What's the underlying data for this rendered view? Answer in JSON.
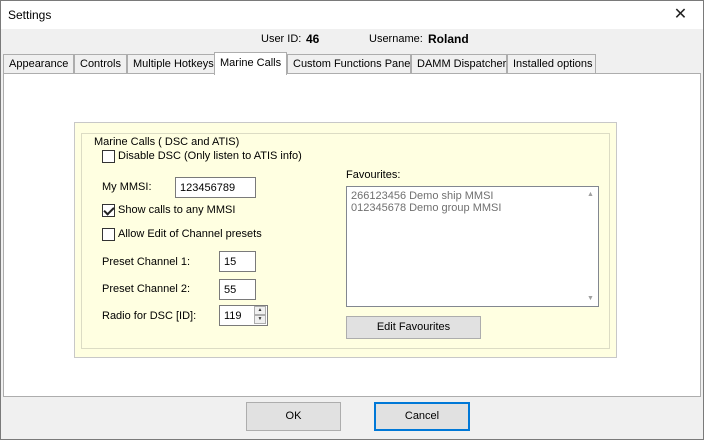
{
  "window": {
    "title": "Settings",
    "close_glyph": "✕"
  },
  "info": {
    "user_id_label": "User ID:",
    "user_id_value": "46",
    "username_label": "Username:",
    "username_value": "Roland"
  },
  "tabs": [
    {
      "label": "Appearance"
    },
    {
      "label": "Controls"
    },
    {
      "label": "Multiple Hotkeys"
    },
    {
      "label": "Marine Calls",
      "active": true
    },
    {
      "label": "Custom Functions Panel"
    },
    {
      "label": "DAMM Dispatcher"
    },
    {
      "label": "Installed options"
    }
  ],
  "marine": {
    "group_title": "Marine Calls ( DSC and ATIS)",
    "disable_dsc": {
      "label": "Disable DSC (Only listen to ATIS info)",
      "checked": false
    },
    "mmsi_label": "My MMSI:",
    "mmsi_value": "123456789",
    "show_calls": {
      "label": "Show calls to any MMSI",
      "checked": true
    },
    "allow_edit": {
      "label": "Allow Edit of Channel presets",
      "checked": false
    },
    "preset1_label": "Preset Channel 1:",
    "preset1_value": "15",
    "preset2_label": "Preset Channel 2:",
    "preset2_value": "55",
    "radio_label": "Radio for DSC [ID]:",
    "radio_value": "119",
    "favourites_label": "Favourites:",
    "favourites": [
      "266123456 Demo ship MMSI",
      "012345678 Demo group MMSI"
    ],
    "edit_favourites_label": "Edit Favourites"
  },
  "buttons": {
    "ok": "OK",
    "cancel": "Cancel"
  }
}
